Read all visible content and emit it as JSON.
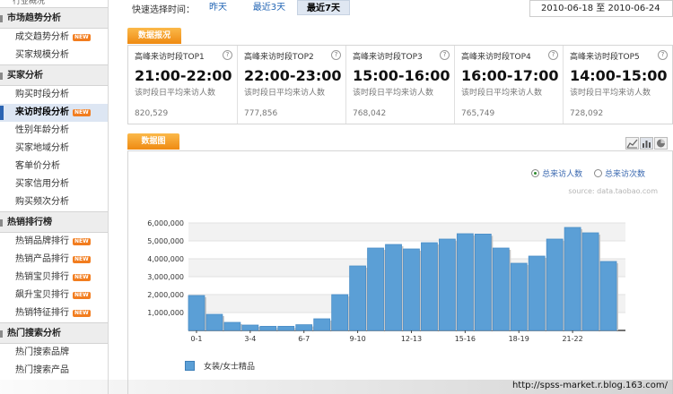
{
  "sidebar": {
    "top_fragment": "行业概况",
    "groups": [
      {
        "title": "市场趋势分析",
        "items": [
          {
            "label": "成交趋势分析",
            "new": true
          },
          {
            "label": "买家规模分析",
            "new": false
          }
        ]
      },
      {
        "title": "买家分析",
        "items": [
          {
            "label": "购买时段分析",
            "new": false
          },
          {
            "label": "来访时段分析",
            "new": true,
            "active": true
          },
          {
            "label": "性别年龄分析",
            "new": false
          },
          {
            "label": "买家地域分析",
            "new": false
          },
          {
            "label": "客单价分析",
            "new": false
          },
          {
            "label": "买家信用分析",
            "new": false
          },
          {
            "label": "购买频次分析",
            "new": false
          }
        ]
      },
      {
        "title": "热销排行榜",
        "items": [
          {
            "label": "热销品牌排行",
            "new": true
          },
          {
            "label": "热销产品排行",
            "new": true
          },
          {
            "label": "热销宝贝排行",
            "new": true
          },
          {
            "label": "飙升宝贝排行",
            "new": true
          },
          {
            "label": "热销特征排行",
            "new": true
          }
        ]
      },
      {
        "title": "热门搜索分析",
        "items": [
          {
            "label": "热门搜索品牌",
            "new": false
          },
          {
            "label": "热门搜索产品",
            "new": false
          }
        ]
      }
    ],
    "new_badge": "NEW"
  },
  "quick": {
    "label": "快速选择时间：",
    "options": [
      "昨天",
      "最近3天",
      "最近7天"
    ],
    "selected": "最近7天",
    "date_range": "2010-06-18 至  2010-06-24"
  },
  "summary": {
    "tab": "数据报况",
    "help_icon": "?",
    "cards": [
      {
        "title": "高峰来访时段TOP1",
        "time": "21:00-22:00",
        "desc": "该时段日平均来访人数",
        "value": "820,529"
      },
      {
        "title": "高峰来访时段TOP2",
        "time": "22:00-23:00",
        "desc": "该时段日平均来访人数",
        "value": "777,856"
      },
      {
        "title": "高峰来访时段TOP3",
        "time": "15:00-16:00",
        "desc": "该时段日平均来访人数",
        "value": "768,042"
      },
      {
        "title": "高峰来访时段TOP4",
        "time": "16:00-17:00",
        "desc": "该时段日平均来访人数",
        "value": "765,749"
      },
      {
        "title": "高峰来访时段TOP5",
        "time": "14:00-15:00",
        "desc": "该时段日平均来访人数",
        "value": "728,092"
      }
    ]
  },
  "chart_panel": {
    "tab": "数据图",
    "icons": [
      "area-chart-icon",
      "bar-chart-icon",
      "pie-chart-icon"
    ],
    "radio_options": [
      {
        "label": "总来访人数",
        "checked": true
      },
      {
        "label": "总来访次数",
        "checked": false
      }
    ],
    "source": "source: data.taobao.com",
    "legend": "女装/女士精品"
  },
  "chart_data": {
    "type": "bar",
    "categories": [
      "0-1",
      "1-2",
      "2-3",
      "3-4",
      "4-5",
      "5-6",
      "6-7",
      "7-8",
      "8-9",
      "9-10",
      "10-11",
      "11-12",
      "12-13",
      "13-14",
      "14-15",
      "15-16",
      "16-17",
      "17-18",
      "18-19",
      "19-20",
      "20-21",
      "21-22",
      "22-23",
      "23-24"
    ],
    "tick_labels": [
      "0-1",
      "3-4",
      "6-7",
      "9-10",
      "12-13",
      "15-16",
      "18-19",
      "21-22"
    ],
    "series": [
      {
        "name": "女装/女士精品",
        "values": [
          1950000,
          900000,
          450000,
          300000,
          230000,
          230000,
          320000,
          650000,
          2000000,
          3600000,
          4600000,
          4800000,
          4550000,
          4900000,
          5100000,
          5400000,
          5380000,
          4600000,
          3750000,
          4150000,
          5100000,
          5750000,
          5450000,
          3850000
        ]
      }
    ],
    "y_ticks": [
      "1,000,000",
      "2,000,000",
      "3,000,000",
      "4,000,000",
      "5,000,000",
      "6,000,000"
    ],
    "ylim": [
      0,
      6000000
    ],
    "grid": true,
    "bar_color": "#5b9fd6",
    "legend_position": "bottom-left"
  },
  "watermark": "http://spss-market.r.blog.163.com/"
}
